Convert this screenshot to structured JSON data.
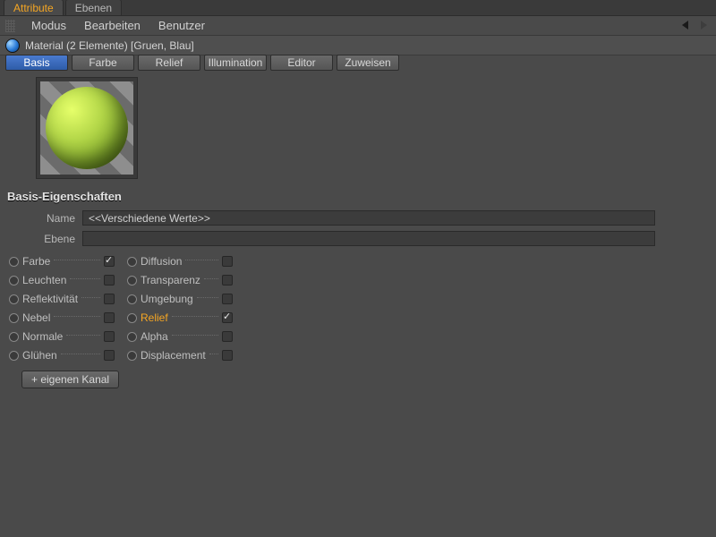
{
  "topTabs": {
    "active": "Attribute",
    "inactive": "Ebenen"
  },
  "menu": {
    "modus": "Modus",
    "bearbeiten": "Bearbeiten",
    "benutzer": "Benutzer"
  },
  "material": {
    "title": "Material (2 Elemente) [Gruen, Blau]"
  },
  "chanTabs": {
    "basis": "Basis",
    "farbe": "Farbe",
    "relief": "Relief",
    "illumination": "Illumination",
    "editor": "Editor",
    "zuweisen": "Zuweisen"
  },
  "section": {
    "head": "Basis-Eigenschaften"
  },
  "fields": {
    "nameLabel": "Name",
    "nameValue": "<<Verschiedene Werte>>",
    "ebeneLabel": "Ebene",
    "ebeneValue": ""
  },
  "channels": {
    "col1": [
      {
        "label": "Farbe",
        "checked": true
      },
      {
        "label": "Leuchten",
        "checked": false
      },
      {
        "label": "Reflektivität",
        "checked": false
      },
      {
        "label": "Nebel",
        "checked": false
      },
      {
        "label": "Normale",
        "checked": false
      },
      {
        "label": "Glühen",
        "checked": false
      }
    ],
    "col2": [
      {
        "label": "Diffusion",
        "checked": false
      },
      {
        "label": "Transparenz",
        "checked": false
      },
      {
        "label": "Umgebung",
        "checked": false
      },
      {
        "label": "Relief",
        "checked": true,
        "hot": true
      },
      {
        "label": "Alpha",
        "checked": false
      },
      {
        "label": "Displacement",
        "checked": false
      }
    ]
  },
  "ownChannel": "+ eigenen Kanal",
  "colors": {
    "accent": "#f5a623",
    "selBlue": "#3a6cc0"
  }
}
